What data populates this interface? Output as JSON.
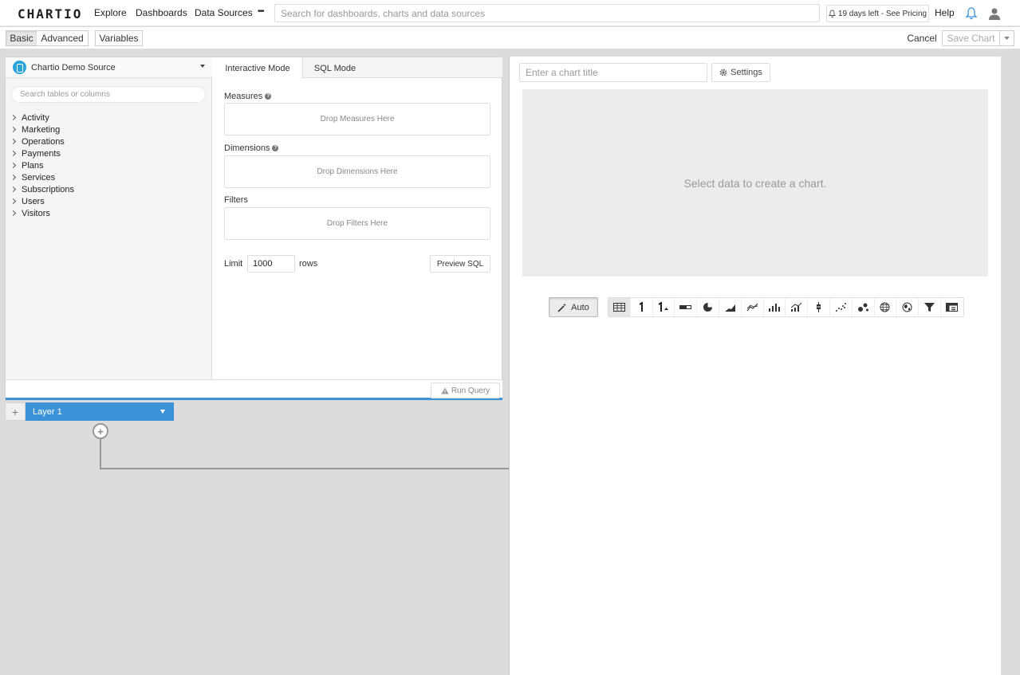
{
  "nav": {
    "logo": "CHARTIO",
    "links": [
      "Explore",
      "Dashboards",
      "Data Sources",
      "•••"
    ],
    "search_placeholder": "Search for dashboards, charts and data sources",
    "trial_text": "19 days left - See Pricing",
    "help": "Help"
  },
  "toolbar": {
    "basic": "Basic",
    "advanced": "Advanced",
    "variables": "Variables",
    "cancel": "Cancel",
    "save": "Save Chart"
  },
  "source": {
    "name": "Chartio Demo Source",
    "search_placeholder": "Search tables or columns",
    "tables": [
      "Activity",
      "Marketing",
      "Operations",
      "Payments",
      "Plans",
      "Services",
      "Subscriptions",
      "Users",
      "Visitors"
    ]
  },
  "query": {
    "tabs": [
      "Interactive Mode",
      "SQL Mode"
    ],
    "measures_label": "Measures",
    "measures_drop": "Drop Measures Here",
    "dimensions_label": "Dimensions",
    "dimensions_drop": "Drop Dimensions Here",
    "filters_label": "Filters",
    "filters_drop": "Drop Filters Here",
    "limit_label": "Limit",
    "limit_value": "1000",
    "rows_label": "rows",
    "preview_sql": "Preview SQL",
    "run_query": "Run Query"
  },
  "layers": {
    "add": "+",
    "layer_name": "Layer 1"
  },
  "chart": {
    "title_placeholder": "Enter a chart title",
    "settings": "Settings",
    "empty_message": "Select data to create a chart.",
    "auto": "Auto",
    "types": [
      "table-icon",
      "single-value-icon",
      "single-value-trend-icon",
      "progress-bar-icon",
      "pie-icon",
      "area-icon",
      "line-icon",
      "bar-icon",
      "bar-line-icon",
      "box-plot-icon",
      "scatter-icon",
      "bubble-icon",
      "globe-icon",
      "geo-map-icon",
      "funnel-icon",
      "pivot-icon"
    ]
  },
  "colors": {
    "accent": "#3c92d6",
    "db_icon": "#2aa4dc"
  }
}
